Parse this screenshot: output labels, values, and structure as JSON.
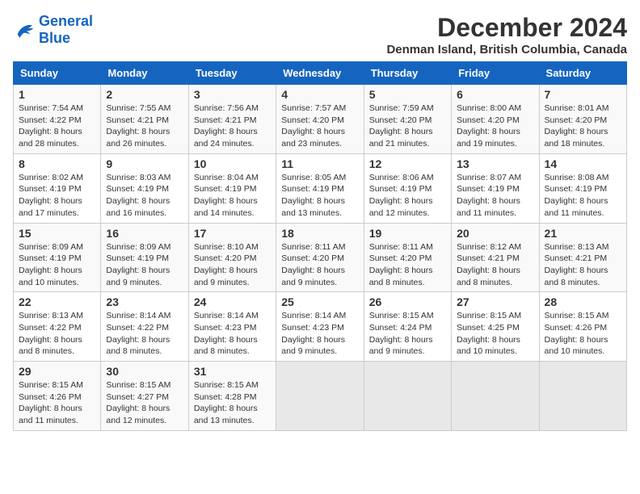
{
  "logo": {
    "line1": "General",
    "line2": "Blue"
  },
  "title": "December 2024",
  "subtitle": "Denman Island, British Columbia, Canada",
  "days_of_week": [
    "Sunday",
    "Monday",
    "Tuesday",
    "Wednesday",
    "Thursday",
    "Friday",
    "Saturday"
  ],
  "weeks": [
    [
      {
        "day": "1",
        "sunrise": "7:54 AM",
        "sunset": "4:22 PM",
        "daylight": "8 hours and 28 minutes."
      },
      {
        "day": "2",
        "sunrise": "7:55 AM",
        "sunset": "4:21 PM",
        "daylight": "8 hours and 26 minutes."
      },
      {
        "day": "3",
        "sunrise": "7:56 AM",
        "sunset": "4:21 PM",
        "daylight": "8 hours and 24 minutes."
      },
      {
        "day": "4",
        "sunrise": "7:57 AM",
        "sunset": "4:20 PM",
        "daylight": "8 hours and 23 minutes."
      },
      {
        "day": "5",
        "sunrise": "7:59 AM",
        "sunset": "4:20 PM",
        "daylight": "8 hours and 21 minutes."
      },
      {
        "day": "6",
        "sunrise": "8:00 AM",
        "sunset": "4:20 PM",
        "daylight": "8 hours and 19 minutes."
      },
      {
        "day": "7",
        "sunrise": "8:01 AM",
        "sunset": "4:20 PM",
        "daylight": "8 hours and 18 minutes."
      }
    ],
    [
      {
        "day": "8",
        "sunrise": "8:02 AM",
        "sunset": "4:19 PM",
        "daylight": "8 hours and 17 minutes."
      },
      {
        "day": "9",
        "sunrise": "8:03 AM",
        "sunset": "4:19 PM",
        "daylight": "8 hours and 16 minutes."
      },
      {
        "day": "10",
        "sunrise": "8:04 AM",
        "sunset": "4:19 PM",
        "daylight": "8 hours and 14 minutes."
      },
      {
        "day": "11",
        "sunrise": "8:05 AM",
        "sunset": "4:19 PM",
        "daylight": "8 hours and 13 minutes."
      },
      {
        "day": "12",
        "sunrise": "8:06 AM",
        "sunset": "4:19 PM",
        "daylight": "8 hours and 12 minutes."
      },
      {
        "day": "13",
        "sunrise": "8:07 AM",
        "sunset": "4:19 PM",
        "daylight": "8 hours and 11 minutes."
      },
      {
        "day": "14",
        "sunrise": "8:08 AM",
        "sunset": "4:19 PM",
        "daylight": "8 hours and 11 minutes."
      }
    ],
    [
      {
        "day": "15",
        "sunrise": "8:09 AM",
        "sunset": "4:19 PM",
        "daylight": "8 hours and 10 minutes."
      },
      {
        "day": "16",
        "sunrise": "8:09 AM",
        "sunset": "4:19 PM",
        "daylight": "8 hours and 9 minutes."
      },
      {
        "day": "17",
        "sunrise": "8:10 AM",
        "sunset": "4:20 PM",
        "daylight": "8 hours and 9 minutes."
      },
      {
        "day": "18",
        "sunrise": "8:11 AM",
        "sunset": "4:20 PM",
        "daylight": "8 hours and 9 minutes."
      },
      {
        "day": "19",
        "sunrise": "8:11 AM",
        "sunset": "4:20 PM",
        "daylight": "8 hours and 8 minutes."
      },
      {
        "day": "20",
        "sunrise": "8:12 AM",
        "sunset": "4:21 PM",
        "daylight": "8 hours and 8 minutes."
      },
      {
        "day": "21",
        "sunrise": "8:13 AM",
        "sunset": "4:21 PM",
        "daylight": "8 hours and 8 minutes."
      }
    ],
    [
      {
        "day": "22",
        "sunrise": "8:13 AM",
        "sunset": "4:22 PM",
        "daylight": "8 hours and 8 minutes."
      },
      {
        "day": "23",
        "sunrise": "8:14 AM",
        "sunset": "4:22 PM",
        "daylight": "8 hours and 8 minutes."
      },
      {
        "day": "24",
        "sunrise": "8:14 AM",
        "sunset": "4:23 PM",
        "daylight": "8 hours and 8 minutes."
      },
      {
        "day": "25",
        "sunrise": "8:14 AM",
        "sunset": "4:23 PM",
        "daylight": "8 hours and 9 minutes."
      },
      {
        "day": "26",
        "sunrise": "8:15 AM",
        "sunset": "4:24 PM",
        "daylight": "8 hours and 9 minutes."
      },
      {
        "day": "27",
        "sunrise": "8:15 AM",
        "sunset": "4:25 PM",
        "daylight": "8 hours and 10 minutes."
      },
      {
        "day": "28",
        "sunrise": "8:15 AM",
        "sunset": "4:26 PM",
        "daylight": "8 hours and 10 minutes."
      }
    ],
    [
      {
        "day": "29",
        "sunrise": "8:15 AM",
        "sunset": "4:26 PM",
        "daylight": "8 hours and 11 minutes."
      },
      {
        "day": "30",
        "sunrise": "8:15 AM",
        "sunset": "4:27 PM",
        "daylight": "8 hours and 12 minutes."
      },
      {
        "day": "31",
        "sunrise": "8:15 AM",
        "sunset": "4:28 PM",
        "daylight": "8 hours and 13 minutes."
      },
      null,
      null,
      null,
      null
    ]
  ],
  "labels": {
    "sunrise": "Sunrise: ",
    "sunset": "Sunset: ",
    "daylight": "Daylight: "
  }
}
